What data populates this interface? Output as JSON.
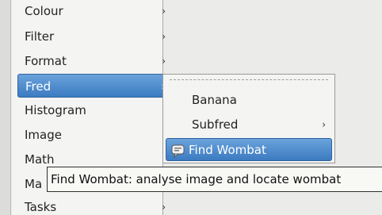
{
  "menu": {
    "items": [
      {
        "label": "Colour",
        "arrow": "›"
      },
      {
        "label": "Filter",
        "arrow": "›"
      },
      {
        "label": "Format",
        "arrow": "›"
      },
      {
        "label": "Fred",
        "arrow": "›",
        "selected": true
      },
      {
        "label": "Histogram",
        "arrow": "›"
      },
      {
        "label": "Image",
        "arrow": "›"
      },
      {
        "label": "Math",
        "arrow": "›"
      },
      {
        "label": "Ma",
        "arrow": "›"
      },
      {
        "label": "Tasks",
        "arrow": "›"
      }
    ]
  },
  "submenu": {
    "items": [
      {
        "label": "Banana"
      },
      {
        "label": "Subfred",
        "arrow": "›"
      },
      {
        "label": "Find Wombat",
        "icon": "chat-icon",
        "selected": true
      }
    ]
  },
  "tooltip": {
    "text": "Find Wombat: analyse image and locate wombat"
  },
  "colors": {
    "selection": "#3c7bc1",
    "menu_bg": "#f4f4f3",
    "tooltip_bg": "#f8f8f5"
  }
}
